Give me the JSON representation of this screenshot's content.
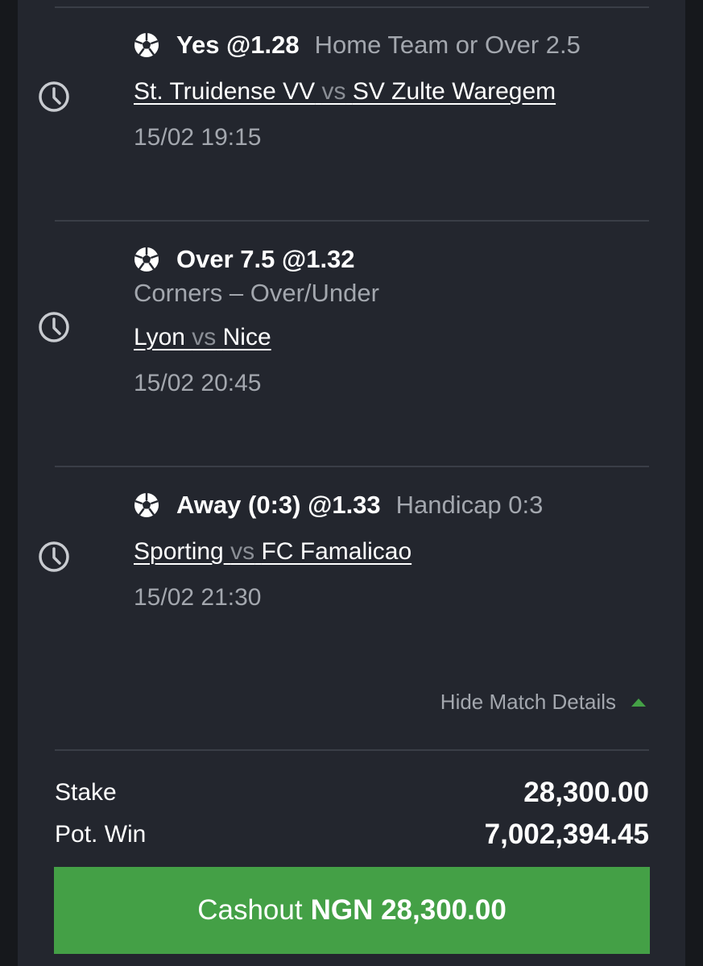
{
  "bets": [
    {
      "pick": "Yes @1.28",
      "market": "Home Team or Over 2.5",
      "home": "St. Truidense VV",
      "vs": "vs",
      "away": "SV Zulte Waregem",
      "datetime": "15/02 19:15"
    },
    {
      "pick": "Over 7.5 @1.32",
      "market": "Corners  –  Over/Under",
      "home": "Lyon",
      "vs": "vs",
      "away": "Nice",
      "datetime": "15/02 20:45"
    },
    {
      "pick": "Away (0:3) @1.33",
      "market": "Handicap 0:3",
      "home": "Sporting",
      "vs": "vs",
      "away": "FC Famalicao",
      "datetime": "15/02 21:30"
    }
  ],
  "details_toggle": "Hide Match Details",
  "summary": {
    "stake_label": "Stake",
    "stake_value": "28,300.00",
    "potwin_label": "Pot. Win",
    "potwin_value": "7,002,394.45"
  },
  "cashout": {
    "prefix": "Cashout",
    "amount": "NGN 28,300.00"
  },
  "colors": {
    "background": "#23262e",
    "accent_green": "#44a046",
    "muted_text": "#a3a7ae"
  }
}
